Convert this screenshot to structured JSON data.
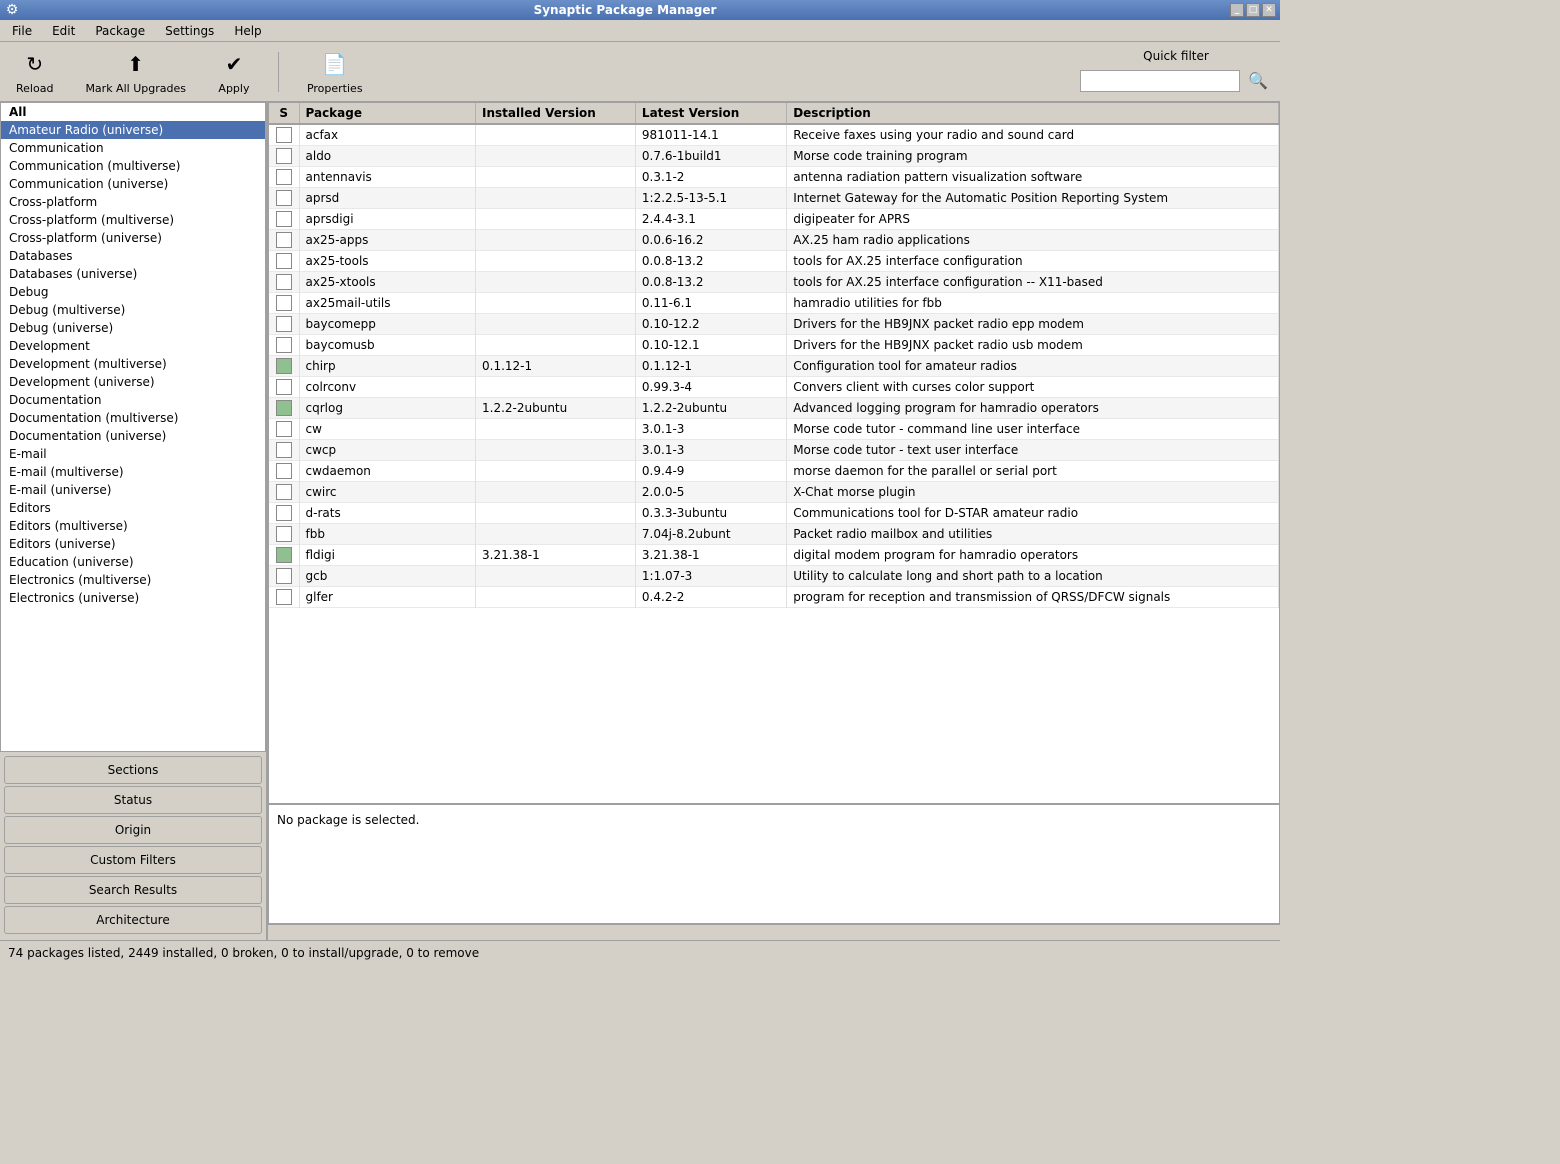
{
  "titlebar": {
    "title": "Synaptic Package Manager",
    "controls": [
      "minimize",
      "maximize",
      "close"
    ]
  },
  "menubar": {
    "items": [
      "File",
      "Edit",
      "Package",
      "Settings",
      "Help"
    ]
  },
  "toolbar": {
    "reload_label": "Reload",
    "mark_upgrades_label": "Mark All Upgrades",
    "apply_label": "Apply",
    "properties_label": "Properties",
    "quick_filter_label": "Quick filter",
    "search_placeholder": ""
  },
  "sidebar": {
    "items": [
      {
        "label": "All",
        "bold": true,
        "selected": false
      },
      {
        "label": "Amateur Radio (universe)",
        "bold": false,
        "selected": true
      },
      {
        "label": "Communication",
        "bold": false,
        "selected": false
      },
      {
        "label": "Communication (multiverse)",
        "bold": false,
        "selected": false
      },
      {
        "label": "Communication (universe)",
        "bold": false,
        "selected": false
      },
      {
        "label": "Cross-platform",
        "bold": false,
        "selected": false
      },
      {
        "label": "Cross-platform (multiverse)",
        "bold": false,
        "selected": false
      },
      {
        "label": "Cross-platform (universe)",
        "bold": false,
        "selected": false
      },
      {
        "label": "Databases",
        "bold": false,
        "selected": false
      },
      {
        "label": "Databases (universe)",
        "bold": false,
        "selected": false
      },
      {
        "label": "Debug",
        "bold": false,
        "selected": false
      },
      {
        "label": "Debug (multiverse)",
        "bold": false,
        "selected": false
      },
      {
        "label": "Debug (universe)",
        "bold": false,
        "selected": false
      },
      {
        "label": "Development",
        "bold": false,
        "selected": false
      },
      {
        "label": "Development (multiverse)",
        "bold": false,
        "selected": false
      },
      {
        "label": "Development (universe)",
        "bold": false,
        "selected": false
      },
      {
        "label": "Documentation",
        "bold": false,
        "selected": false
      },
      {
        "label": "Documentation (multiverse)",
        "bold": false,
        "selected": false
      },
      {
        "label": "Documentation (universe)",
        "bold": false,
        "selected": false
      },
      {
        "label": "E-mail",
        "bold": false,
        "selected": false
      },
      {
        "label": "E-mail (multiverse)",
        "bold": false,
        "selected": false
      },
      {
        "label": "E-mail (universe)",
        "bold": false,
        "selected": false
      },
      {
        "label": "Editors",
        "bold": false,
        "selected": false
      },
      {
        "label": "Editors (multiverse)",
        "bold": false,
        "selected": false
      },
      {
        "label": "Editors (universe)",
        "bold": false,
        "selected": false
      },
      {
        "label": "Education (universe)",
        "bold": false,
        "selected": false
      },
      {
        "label": "Electronics (multiverse)",
        "bold": false,
        "selected": false
      },
      {
        "label": "Electronics (universe)",
        "bold": false,
        "selected": false
      }
    ],
    "buttons": [
      {
        "label": "Sections"
      },
      {
        "label": "Status"
      },
      {
        "label": "Origin"
      },
      {
        "label": "Custom Filters"
      },
      {
        "label": "Search Results"
      },
      {
        "label": "Architecture"
      }
    ]
  },
  "table": {
    "columns": [
      "S",
      "Package",
      "Installed Version",
      "Latest Version",
      "Description"
    ],
    "rows": [
      {
        "status": "empty",
        "package": "acfax",
        "installed": "",
        "latest": "981011-14.1",
        "description": "Receive faxes using your radio and sound card"
      },
      {
        "status": "empty",
        "package": "aldo",
        "installed": "",
        "latest": "0.7.6-1build1",
        "description": "Morse code training program"
      },
      {
        "status": "empty",
        "package": "antennavis",
        "installed": "",
        "latest": "0.3.1-2",
        "description": "antenna radiation pattern visualization software"
      },
      {
        "status": "empty",
        "package": "aprsd",
        "installed": "",
        "latest": "1:2.2.5-13-5.1",
        "description": "Internet Gateway for the Automatic Position Reporting System"
      },
      {
        "status": "empty",
        "package": "aprsdigi",
        "installed": "",
        "latest": "2.4.4-3.1",
        "description": "digipeater for APRS"
      },
      {
        "status": "empty",
        "package": "ax25-apps",
        "installed": "",
        "latest": "0.0.6-16.2",
        "description": "AX.25 ham radio applications"
      },
      {
        "status": "empty",
        "package": "ax25-tools",
        "installed": "",
        "latest": "0.0.8-13.2",
        "description": "tools for AX.25 interface configuration"
      },
      {
        "status": "empty",
        "package": "ax25-xtools",
        "installed": "",
        "latest": "0.0.8-13.2",
        "description": "tools for AX.25 interface configuration -- X11-based"
      },
      {
        "status": "empty",
        "package": "ax25mail-utils",
        "installed": "",
        "latest": "0.11-6.1",
        "description": "hamradio utilities for fbb"
      },
      {
        "status": "empty",
        "package": "baycomepp",
        "installed": "",
        "latest": "0.10-12.2",
        "description": "Drivers for the HB9JNX packet radio epp modem"
      },
      {
        "status": "empty",
        "package": "baycomusb",
        "installed": "",
        "latest": "0.10-12.1",
        "description": "Drivers for the HB9JNX packet radio usb modem"
      },
      {
        "status": "installed",
        "package": "chirp",
        "installed": "0.1.12-1",
        "latest": "0.1.12-1",
        "description": "Configuration tool for amateur radios"
      },
      {
        "status": "empty",
        "package": "colrconv",
        "installed": "",
        "latest": "0.99.3-4",
        "description": "Convers client with curses color support"
      },
      {
        "status": "installed",
        "package": "cqrlog",
        "installed": "1.2.2-2ubuntu",
        "latest": "1.2.2-2ubuntu",
        "description": "Advanced logging program for hamradio operators"
      },
      {
        "status": "empty",
        "package": "cw",
        "installed": "",
        "latest": "3.0.1-3",
        "description": "Morse code tutor - command line user interface"
      },
      {
        "status": "empty",
        "package": "cwcp",
        "installed": "",
        "latest": "3.0.1-3",
        "description": "Morse code tutor - text user interface"
      },
      {
        "status": "empty",
        "package": "cwdaemon",
        "installed": "",
        "latest": "0.9.4-9",
        "description": "morse daemon for the parallel or serial port"
      },
      {
        "status": "empty",
        "package": "cwirc",
        "installed": "",
        "latest": "2.0.0-5",
        "description": "X-Chat morse plugin"
      },
      {
        "status": "empty",
        "package": "d-rats",
        "installed": "",
        "latest": "0.3.3-3ubuntu",
        "description": "Communications tool for D-STAR amateur radio"
      },
      {
        "status": "empty",
        "package": "fbb",
        "installed": "",
        "latest": "7.04j-8.2ubunt",
        "description": "Packet radio mailbox and utilities"
      },
      {
        "status": "installed",
        "package": "fldigi",
        "installed": "3.21.38-1",
        "latest": "3.21.38-1",
        "description": "digital modem program for hamradio operators"
      },
      {
        "status": "empty",
        "package": "gcb",
        "installed": "",
        "latest": "1:1.07-3",
        "description": "Utility to calculate long and short path to a location"
      },
      {
        "status": "empty",
        "package": "glfer",
        "installed": "",
        "latest": "0.4.2-2",
        "description": "program for reception and transmission of QRSS/DFCW signals"
      }
    ]
  },
  "detail": {
    "text": "No package is selected."
  },
  "statusbar": {
    "text": "74 packages listed, 2449 installed, 0 broken, 0 to install/upgrade, 0 to remove"
  }
}
